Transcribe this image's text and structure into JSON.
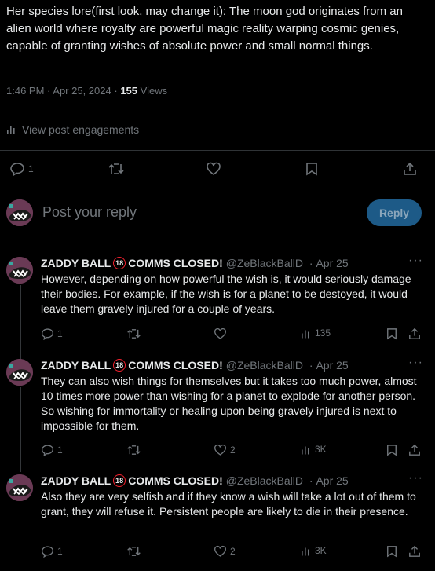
{
  "main_post": {
    "text": "Her species lore(first look, may change it): The moon god originates from an alien world where royalty are powerful magic reality warping cosmic genies, capable of granting wishes of absolute power and small normal things.",
    "time": "1:46 PM",
    "date": "Apr 25, 2024",
    "views_count": "155",
    "views_label": "Views",
    "engagements_label": "View post engagements",
    "reply_count": "1"
  },
  "reply_composer": {
    "placeholder": "Post your reply",
    "button_label": "Reply"
  },
  "replies": [
    {
      "name": "ZADDY BALL",
      "badge": "18",
      "name_suffix": "COMMS CLOSED!",
      "handle": "@ZeBlackBallD",
      "date": "Apr 25",
      "text": "However, depending on how powerful the wish is, it would seriously damage their bodies. For example, if the wish is for a planet to be destoyed, it would leave them gravely  injured for a couple of years.",
      "reply_count": "1",
      "like_count": "",
      "views": "135"
    },
    {
      "name": "ZADDY BALL",
      "badge": "18",
      "name_suffix": "COMMS CLOSED!",
      "handle": "@ZeBlackBallD",
      "date": "Apr 25",
      "text": "They can also wish things for themselves but it takes too much power, almost 10 times more power than wishing for a planet to explode for another person. So wishing for immortality or healing upon being gravely injured is next to impossible for them.",
      "reply_count": "1",
      "like_count": "2",
      "views": "3K"
    },
    {
      "name": "ZADDY BALL",
      "badge": "18",
      "name_suffix": "COMMS CLOSED!",
      "handle": "@ZeBlackBallD",
      "date": "Apr 25",
      "text": "Also they are very selfish and if they know a wish will take a lot out of them to grant, they will refuse it. Persistent people are likely to die in their presence.",
      "reply_count": "1",
      "like_count": "2",
      "views": "3K"
    }
  ],
  "colors": {
    "background": "#000000",
    "text": "#e7e9ea",
    "muted": "#71767b",
    "divider": "#2f3336",
    "reply_button": "#1d5a87",
    "badge_ring": "#f4212e"
  },
  "icons": [
    "reply-icon",
    "retweet-icon",
    "like-icon",
    "bookmark-icon",
    "share-icon",
    "analytics-icon",
    "more-icon"
  ]
}
